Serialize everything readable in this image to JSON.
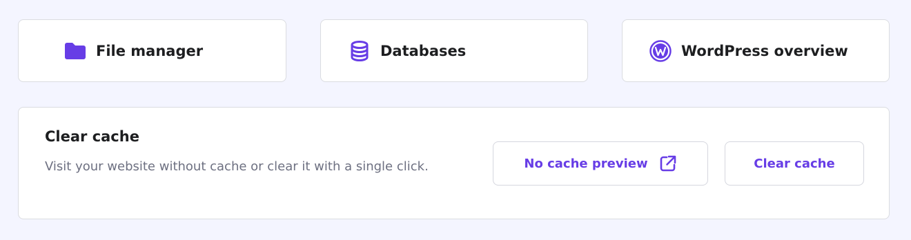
{
  "colors": {
    "background": "#f4f5ff",
    "card": "#ffffff",
    "border": "#dadce0",
    "accent": "#673de6",
    "text_primary": "#1d1e20",
    "text_secondary": "#6d7081"
  },
  "quick_links": [
    {
      "label": "File manager",
      "icon": "folder-icon"
    },
    {
      "label": "Databases",
      "icon": "database-icon"
    },
    {
      "label": "WordPress overview",
      "icon": "wordpress-icon"
    }
  ],
  "cache": {
    "title": "Clear cache",
    "description": "Visit your website without cache or clear it with a single click.",
    "no_cache_button": {
      "label": "No cache preview",
      "icon": "external-link-icon"
    },
    "clear_button": {
      "label": "Clear cache"
    }
  }
}
